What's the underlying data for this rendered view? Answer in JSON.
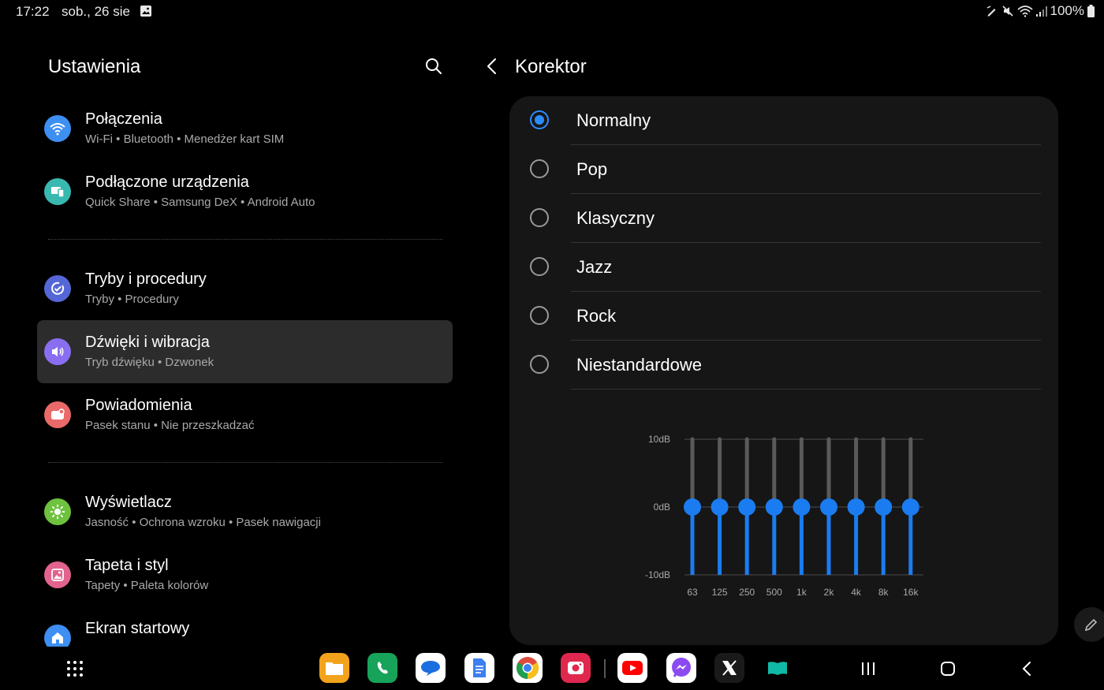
{
  "status_bar": {
    "time": "17:22",
    "date": "sob., 26 sie",
    "battery": "100%"
  },
  "left_panel": {
    "title": "Ustawienia",
    "items": [
      {
        "title": "Połączenia",
        "subtitle": "Wi-Fi  •  Bluetooth  •  Menedżer kart SIM",
        "icon": "wifi-icon",
        "color": "#3d8ff2"
      },
      {
        "title": "Podłączone urządzenia",
        "subtitle": "Quick Share  •  Samsung DeX  •  Android Auto",
        "icon": "devices-icon",
        "color": "#39b8b0"
      },
      {
        "title": "Tryby i procedury",
        "subtitle": "Tryby  •  Procedury",
        "icon": "routines-icon",
        "color": "#5567d6"
      },
      {
        "title": "Dźwięki i wibracja",
        "subtitle": "Tryb dźwięku  •  Dzwonek",
        "icon": "speaker-icon",
        "color": "#8a6ef0"
      },
      {
        "title": "Powiadomienia",
        "subtitle": "Pasek stanu  •  Nie przeszkadzać",
        "icon": "notification-icon",
        "color": "#e96a68"
      },
      {
        "title": "Wyświetlacz",
        "subtitle": "Jasność  •  Ochrona wzroku  •  Pasek nawigacji",
        "icon": "brightness-icon",
        "color": "#6ec23e"
      },
      {
        "title": "Tapeta i styl",
        "subtitle": "Tapety  •  Paleta kolorów",
        "icon": "wallpaper-icon",
        "color": "#e2648e"
      },
      {
        "title": "Ekran startowy",
        "subtitle": "",
        "icon": "home-icon",
        "color": "#3d8ff2"
      }
    ]
  },
  "right_panel": {
    "title": "Korektor",
    "presets": [
      "Normalny",
      "Pop",
      "Klasyczny",
      "Jazz",
      "Rock",
      "Niestandardowe"
    ],
    "selected_preset": "Normalny",
    "equalizer": {
      "ticks": [
        "10dB",
        "0dB",
        "-10dB"
      ],
      "bands": [
        "63",
        "125",
        "250",
        "500",
        "1k",
        "2k",
        "4k",
        "8k",
        "16k"
      ],
      "gains_db": [
        0,
        0,
        0,
        0,
        0,
        0,
        0,
        0,
        0
      ],
      "range_db": [
        -10,
        10
      ],
      "accent": "#1a7cf0"
    }
  },
  "taskbar": {
    "apps": [
      {
        "name": "files-app",
        "color": "#f2a31b"
      },
      {
        "name": "phone-app",
        "color": "#17a35a"
      },
      {
        "name": "messages-app",
        "color": "#ffffff"
      },
      {
        "name": "docs-app",
        "color": "#ffffff"
      },
      {
        "name": "chrome-app",
        "color": "#ffffff"
      },
      {
        "name": "screen-recorder-app",
        "color": "#e0284e"
      },
      {
        "name": "youtube-app",
        "color": "#ffffff"
      },
      {
        "name": "messenger-app",
        "color": "#ffffff"
      },
      {
        "name": "x-app",
        "color": "#1a1a1a"
      },
      {
        "name": "book-app",
        "color": "#10b9a5"
      }
    ]
  }
}
